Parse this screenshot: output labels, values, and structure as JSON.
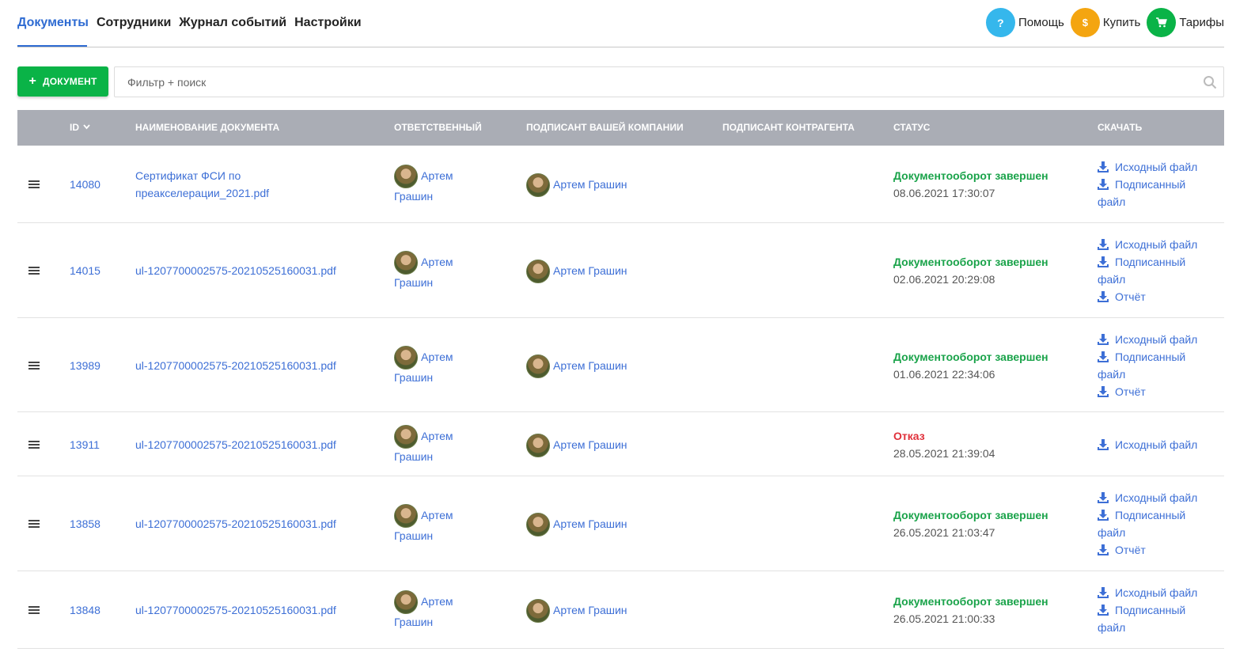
{
  "nav": {
    "tabs": [
      {
        "label": "Документы",
        "active": true
      },
      {
        "label": "Сотрудники",
        "active": false
      },
      {
        "label": "Журнал событий",
        "active": false
      },
      {
        "label": "Настройки",
        "active": false
      }
    ],
    "actions": [
      {
        "label": "Помощь",
        "glyph": "?",
        "color": "#35b7ec",
        "icon": "help-icon"
      },
      {
        "label": "Купить",
        "glyph": "$",
        "color": "#f4a510",
        "icon": "dollar-icon"
      },
      {
        "label": "Тарифы",
        "glyph": "cart",
        "color": "#0ab347",
        "icon": "cart-icon"
      }
    ]
  },
  "toolbar": {
    "add_label": "ДОКУМЕНТ",
    "search_placeholder": "Фильтр + поиск"
  },
  "table": {
    "headers": {
      "id": "ID",
      "name": "НАИМЕНОВАНИЕ ДОКУМЕНТА",
      "responsible": "ОТВЕТСТВЕННЫЙ",
      "signer": "ПОДПИСАНТ ВАШЕЙ КОМПАНИИ",
      "counterparty": "ПОДПИСАНТ КОНТРАГЕНТА",
      "status": "СТАТУС",
      "download": "СКАЧАТЬ"
    },
    "rows": [
      {
        "id": "14080",
        "name_lines": [
          "Сертификат ФСИ по",
          "преакселерации_2021.pdf"
        ],
        "responsible": [
          "Артем",
          "Грашин"
        ],
        "signer": "Артем Грашин",
        "status": "Документооборот завершен",
        "status_type": "ok",
        "date": "08.06.2021 17:30:07",
        "downloads": [
          "Исходный файл",
          "Подписанный",
          "файл"
        ]
      },
      {
        "id": "14015",
        "name_lines": [
          "ul-1207700002575-20210525160031.pdf"
        ],
        "responsible": [
          "Артем",
          "Грашин"
        ],
        "signer": "Артем Грашин",
        "status": "Документооборот завершен",
        "status_type": "ok",
        "date": "02.06.2021 20:29:08",
        "downloads": [
          "Исходный файл",
          "Подписанный",
          "файл",
          "Отчёт"
        ]
      },
      {
        "id": "13989",
        "name_lines": [
          "ul-1207700002575-20210525160031.pdf"
        ],
        "responsible": [
          "Артем",
          "Грашин"
        ],
        "signer": "Артем Грашин",
        "status": "Документооборот завершен",
        "status_type": "ok",
        "date": "01.06.2021 22:34:06",
        "downloads": [
          "Исходный файл",
          "Подписанный",
          "файл",
          "Отчёт"
        ]
      },
      {
        "id": "13911",
        "name_lines": [
          "ul-1207700002575-20210525160031.pdf"
        ],
        "responsible": [
          "Артем",
          "Грашин"
        ],
        "signer": "Артем Грашин",
        "status": "Отказ",
        "status_type": "fail",
        "date": "28.05.2021 21:39:04",
        "downloads": [
          "Исходный файл"
        ]
      },
      {
        "id": "13858",
        "name_lines": [
          "ul-1207700002575-20210525160031.pdf"
        ],
        "responsible": [
          "Артем",
          "Грашин"
        ],
        "signer": "Артем Грашин",
        "status": "Документооборот завершен",
        "status_type": "ok",
        "date": "26.05.2021 21:03:47",
        "downloads": [
          "Исходный файл",
          "Подписанный",
          "файл",
          "Отчёт"
        ]
      },
      {
        "id": "13848",
        "name_lines": [
          "ul-1207700002575-20210525160031.pdf"
        ],
        "responsible": [
          "Артем",
          "Грашин"
        ],
        "signer": "Артем Грашин",
        "status": "Документооборот завершен",
        "status_type": "ok",
        "date": "26.05.2021 21:00:33",
        "downloads": [
          "Исходный файл",
          "Подписанный",
          "файл"
        ]
      }
    ]
  }
}
